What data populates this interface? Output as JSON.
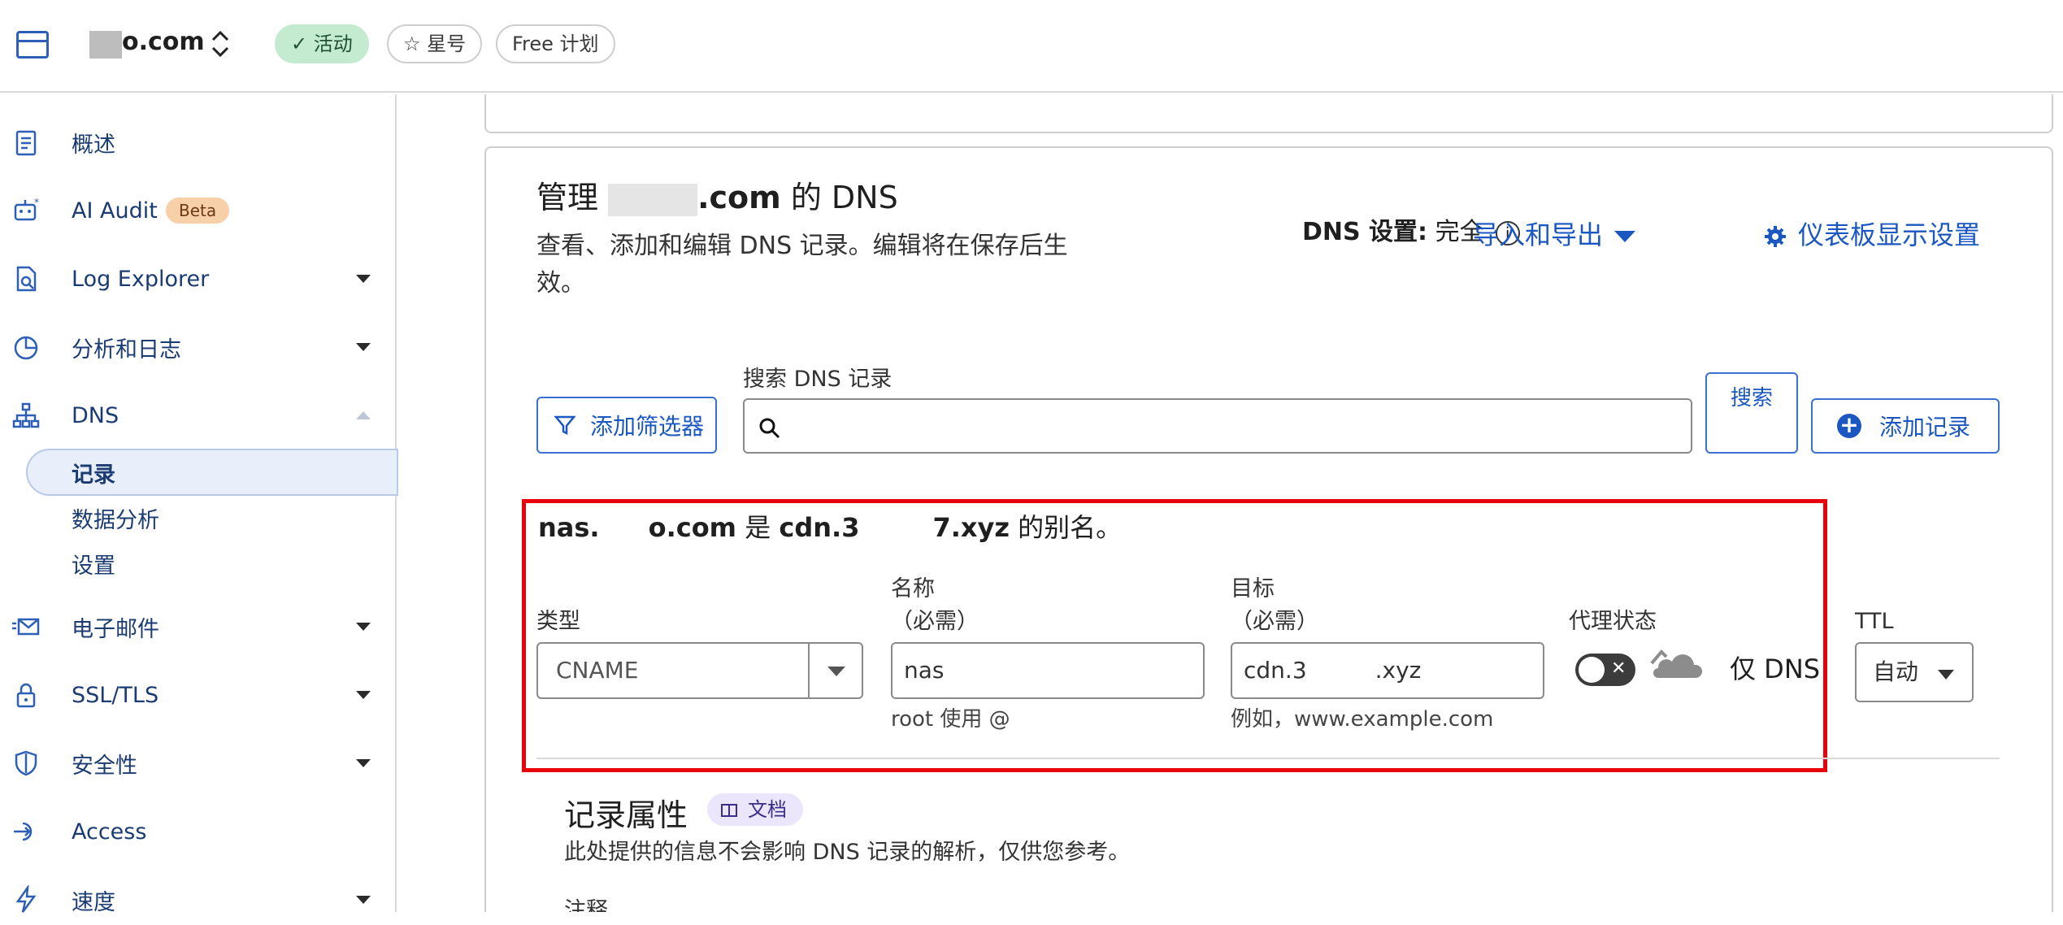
{
  "topbar": {
    "domain": "o.com",
    "badges": {
      "active": "活动",
      "star": "星号",
      "plan": "Free 计划"
    }
  },
  "sidebar": {
    "items": [
      {
        "label": "概述"
      },
      {
        "label": "AI Audit",
        "badge": "Beta"
      },
      {
        "label": "Log Explorer"
      },
      {
        "label": "分析和日志"
      },
      {
        "label": "DNS"
      },
      {
        "label": "电子邮件"
      },
      {
        "label": "SSL/TLS"
      },
      {
        "label": "安全性"
      },
      {
        "label": "Access"
      },
      {
        "label": "速度"
      }
    ],
    "dns_sub": [
      "记录",
      "数据分析",
      "设置"
    ]
  },
  "header": {
    "title_prefix": "管理 ",
    "title_mid": ".com",
    "title_suffix": " 的 DNS",
    "description": "查看、添加和编辑 DNS 记录。编辑将在保存后生效。",
    "dns_setting_label": "DNS 设置:",
    "dns_setting_value": "完全",
    "import_export": "导入和导出",
    "dashboard_settings": "仪表板显示设置"
  },
  "toolbar": {
    "filter_button": "添加筛选器",
    "search_label": "搜索 DNS 记录",
    "search_placeholder": "",
    "search_button": "搜索",
    "add_record_button": "添加记录"
  },
  "record": {
    "alias_name_a": "nas.",
    "alias_name_b": "o.com",
    "alias_is": "是",
    "alias_target_a": "cdn.3",
    "alias_target_b": "7.xyz",
    "alias_suffix": "的别名。",
    "type_label": "类型",
    "type_value": "CNAME",
    "name_label": "名称",
    "name_required": "（必需）",
    "name_value": "nas",
    "name_help": "root 使用 @",
    "target_label": "目标",
    "target_required": "（必需）",
    "target_value_a": "cdn.3",
    "target_value_b": ".xyz",
    "target_help": "例如，www.example.com",
    "proxy_label": "代理状态",
    "proxy_state": "仅 DNS",
    "ttl_label": "TTL",
    "ttl_value": "自动"
  },
  "attributes": {
    "title": "记录属性",
    "doc_badge": "文档",
    "description": "此处提供的信息不会影响 DNS 记录的解析，仅供您参考。",
    "note_label": "注释"
  },
  "colors": {
    "accent": "#1b57c0",
    "highlight": "#e8000b",
    "active_badge": "#c4ead0"
  },
  "icons": [
    "browser-icon",
    "switch-icon",
    "check-icon",
    "star-icon",
    "clipboard-icon",
    "robot-icon",
    "log-icon",
    "pie-chart-icon",
    "sitemap-icon",
    "mail-icon",
    "lock-icon",
    "shield-icon",
    "access-icon",
    "bolt-icon",
    "filter-icon",
    "search-icon",
    "plus-icon",
    "info-icon",
    "gear-icon",
    "cloud-icon",
    "book-icon"
  ]
}
